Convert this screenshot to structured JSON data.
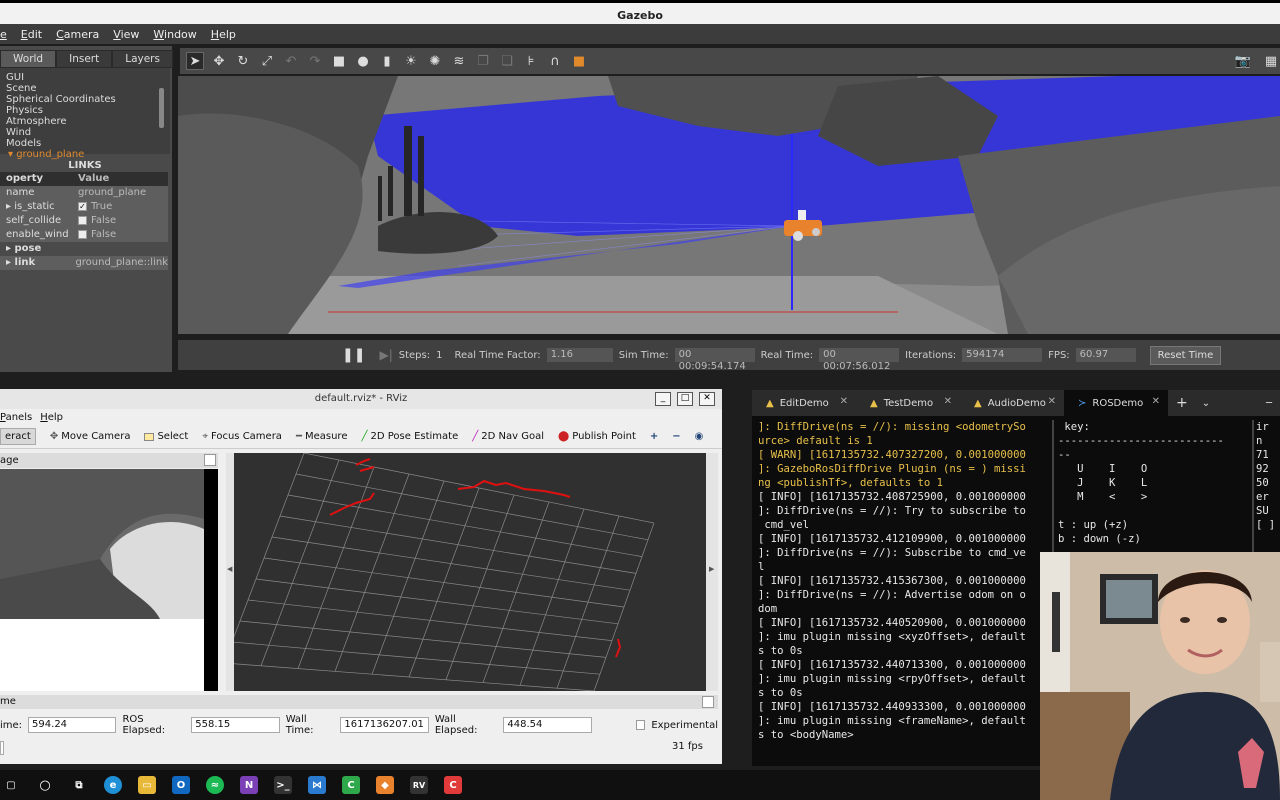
{
  "gazebo": {
    "title": "Gazebo",
    "menu": [
      "e",
      "Edit",
      "Camera",
      "View",
      "Window",
      "Help"
    ],
    "tabs": [
      "World",
      "Insert",
      "Layers"
    ],
    "tree": [
      "GUI",
      "Scene",
      "Spherical Coordinates",
      "Physics",
      "Atmosphere",
      "Wind",
      "Models"
    ],
    "selected_model": "ground_plane",
    "links_header": "LINKS",
    "props_header": {
      "k": "operty",
      "v": "Value"
    },
    "props": [
      {
        "k": "name",
        "v": "ground_plane"
      },
      {
        "k": "is_static",
        "v": "True",
        "checked": true
      },
      {
        "k": "self_collide",
        "v": "False",
        "checked": false
      },
      {
        "k": "enable_wind",
        "v": "False",
        "checked": false
      },
      {
        "k": "pose",
        "v": ""
      },
      {
        "k": "link",
        "v": "ground_plane::link"
      }
    ],
    "status": {
      "steps_label": "Steps:",
      "steps_value": "1",
      "rtf_label": "Real Time Factor:",
      "rtf_value": "1.16",
      "sim_label": "Sim Time:",
      "sim_value": "00 00:09:54.174",
      "real_label": "Real Time:",
      "real_value": "00 00:07:56.012",
      "iter_label": "Iterations:",
      "iter_value": "594174",
      "fps_label": "FPS:",
      "fps_value": "60.97",
      "reset_label": "Reset Time"
    }
  },
  "rviz": {
    "title": "default.rviz* - RViz",
    "menu": [
      "Panels",
      "Help"
    ],
    "tools": [
      "eract",
      "Move Camera",
      "Select",
      "Focus Camera",
      "Measure",
      "2D Pose Estimate",
      "2D Nav Goal",
      "Publish Point"
    ],
    "image_panel": "age",
    "time_panel": "me",
    "time": {
      "ros_time_label": "ime:",
      "ros_time": "594.24",
      "ros_elapsed_label": "ROS Elapsed:",
      "ros_elapsed": "558.15",
      "wall_time_label": "Wall Time:",
      "wall_time": "1617136207.01",
      "wall_elapsed_label": "Wall Elapsed:",
      "wall_elapsed": "448.54",
      "experimental": "Experimental",
      "fps": "31 fps"
    }
  },
  "terminal": {
    "tabs": [
      "EditDemo",
      "TestDemo",
      "AudioDemo",
      "ROSDemo"
    ],
    "log": [
      {
        "t": "]: DiffDrive(ns = //): missing <odometrySo",
        "c": "warn"
      },
      {
        "t": "urce> default is 1",
        "c": "warn"
      },
      {
        "t": "[ WARN] [1617135732.407327200, 0.001000000",
        "c": "warn"
      },
      {
        "t": "]: GazeboRosDiffDrive Plugin (ns = ) missi",
        "c": "warn"
      },
      {
        "t": "ng <publishTf>, defaults to 1",
        "c": "warn"
      },
      {
        "t": "[ INFO] [1617135732.408725900, 0.001000000",
        "c": ""
      },
      {
        "t": "]: DiffDrive(ns = //): Try to subscribe to",
        "c": ""
      },
      {
        "t": " cmd_vel",
        "c": ""
      },
      {
        "t": "[ INFO] [1617135732.412109900, 0.001000000",
        "c": ""
      },
      {
        "t": "]: DiffDrive(ns = //): Subscribe to cmd_ve",
        "c": ""
      },
      {
        "t": "l",
        "c": ""
      },
      {
        "t": "[ INFO] [1617135732.415367300, 0.001000000",
        "c": ""
      },
      {
        "t": "]: DiffDrive(ns = //): Advertise odom on o",
        "c": ""
      },
      {
        "t": "dom",
        "c": ""
      },
      {
        "t": "[ INFO] [1617135732.440520900, 0.001000000",
        "c": ""
      },
      {
        "t": "]: imu plugin missing <xyzOffset>, default",
        "c": ""
      },
      {
        "t": "s to 0s",
        "c": ""
      },
      {
        "t": "[ INFO] [1617135732.440713300, 0.001000000",
        "c": ""
      },
      {
        "t": "]: imu plugin missing <rpyOffset>, default",
        "c": ""
      },
      {
        "t": "s to 0s",
        "c": ""
      },
      {
        "t": "[ INFO] [1617135732.440933300, 0.001000000",
        "c": ""
      },
      {
        "t": "]: imu plugin missing <frameName>, default",
        "c": ""
      },
      {
        "t": "s to <bodyName>",
        "c": ""
      }
    ],
    "keys": [
      " key:",
      "--------------------------",
      "--",
      "   U    I    O",
      "   J    K    L",
      "   M    <    >",
      "",
      "t : up (+z)",
      "b : down (-z)"
    ],
    "right": [
      "ir",
      "n",
      "71",
      "92",
      "50",
      "er",
      "SU",
      "[ ]"
    ]
  },
  "colors": {
    "accent_orange": "#e08a2c",
    "laser_blue": "#2a2ae8",
    "scan_red": "#e01010"
  },
  "taskbar_icons": [
    "start",
    "search",
    "task-view",
    "edge",
    "explorer",
    "outlook",
    "spotify",
    "onenote",
    "terminal",
    "vscode",
    "camtasia",
    "gazebo",
    "rviz",
    "clion"
  ]
}
